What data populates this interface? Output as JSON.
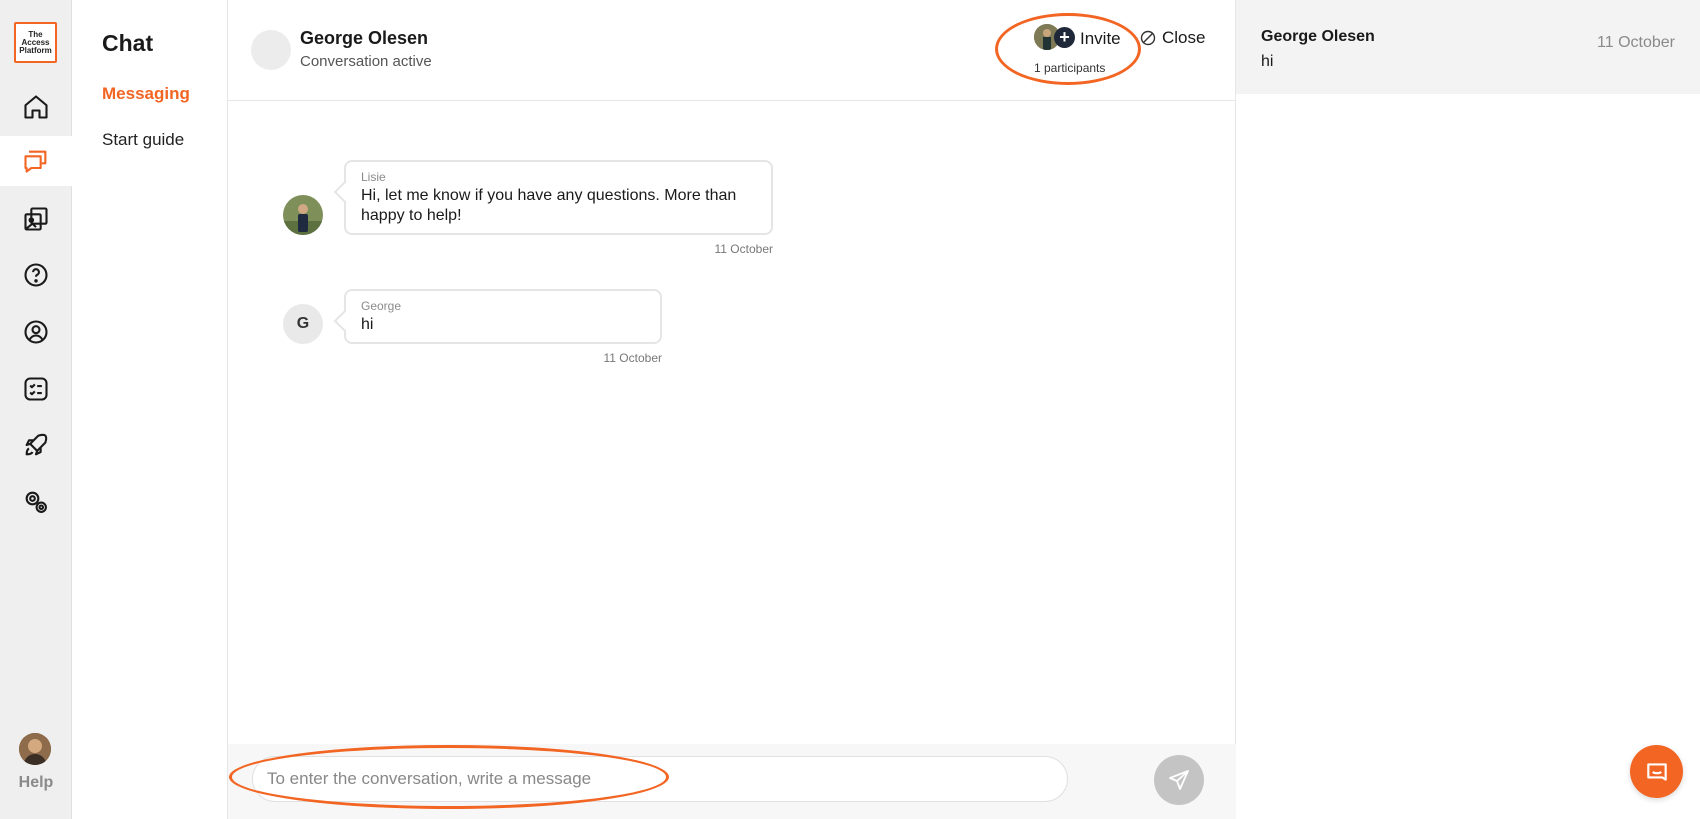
{
  "brand": {
    "logo_text": "The Access Platform",
    "accent": "#f26522"
  },
  "rail": {
    "items": [
      {
        "icon": "home-icon",
        "active": false
      },
      {
        "icon": "chat-icon",
        "active": true
      },
      {
        "icon": "gallery-icon",
        "active": false
      },
      {
        "icon": "help-circle-icon",
        "active": false
      },
      {
        "icon": "user-circle-icon",
        "active": false
      },
      {
        "icon": "checklist-icon",
        "active": false
      },
      {
        "icon": "rocket-icon",
        "active": false
      },
      {
        "icon": "settings-icon",
        "active": false
      }
    ],
    "help_label": "Help"
  },
  "subnav": {
    "title": "Chat",
    "items": [
      {
        "label": "Messaging",
        "active": true
      },
      {
        "label": "Start guide",
        "active": false
      }
    ]
  },
  "conversation": {
    "name": "George Olesen",
    "status": "Conversation active",
    "invite_label": "Invite",
    "participants_label": "1 participants",
    "close_label": "Close",
    "messages": [
      {
        "sender": "Lisie",
        "text": "Hi, let me know if you have any questions. More than happy to help!",
        "date": "11 October",
        "avatar": "photo"
      },
      {
        "sender": "George",
        "text": "hi",
        "date": "11 October",
        "avatar_letter": "G"
      }
    ],
    "input_placeholder": "To enter the conversation, write a message"
  },
  "conversation_list": [
    {
      "name": "George Olesen",
      "preview": "hi",
      "date": "11 October"
    }
  ]
}
